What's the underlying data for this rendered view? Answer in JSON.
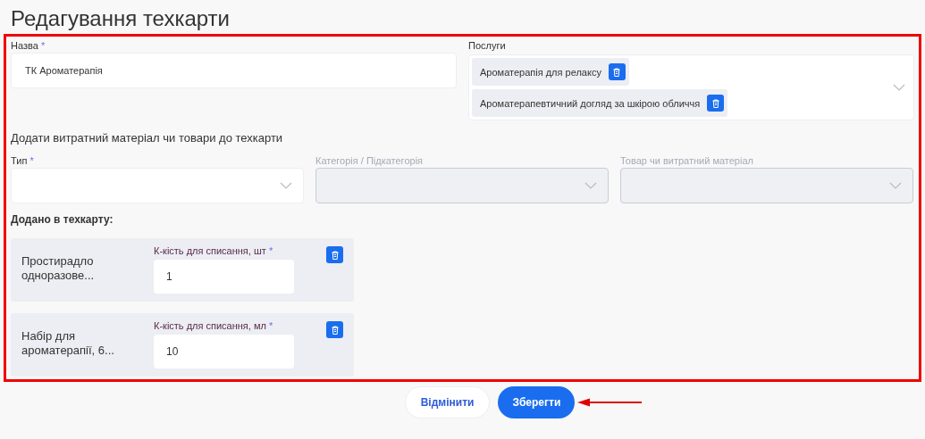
{
  "title": "Редагування техкарти",
  "form": {
    "highlighted": true,
    "name_field": {
      "label": "Назва",
      "required_mark": "*",
      "value": "ТК Ароматерапія"
    },
    "services": {
      "label": "Послуги",
      "items": [
        {
          "label": "Ароматерапія для релаксу"
        },
        {
          "label": "Ароматерапевтичний догляд за шкірою обличчя"
        }
      ]
    },
    "add_heading": "Додати витратний матеріал чи товари до техкарти",
    "selectors": [
      {
        "label": "Тип",
        "required_mark": "*",
        "disabled": false
      },
      {
        "label": "Категорія / Підкатегорія",
        "disabled": true
      },
      {
        "label": "Товар чи витратний матеріал",
        "disabled": true
      }
    ],
    "added_heading": "Додано в техкарту:",
    "added_items": [
      {
        "name": "Простирадло одноразове...",
        "qty_label": "К-кість для списання, шт",
        "required_mark": "*",
        "value": "1"
      },
      {
        "name": "Набір для ароматерапії, 6...",
        "qty_label": "К-кість для списання, мл",
        "required_mark": "*",
        "value": "10"
      }
    ]
  },
  "buttons": [
    {
      "label": "Відмінити",
      "kind": "secondary",
      "pointed": false
    },
    {
      "label": "Зберегти",
      "kind": "primary",
      "pointed": true
    }
  ]
}
